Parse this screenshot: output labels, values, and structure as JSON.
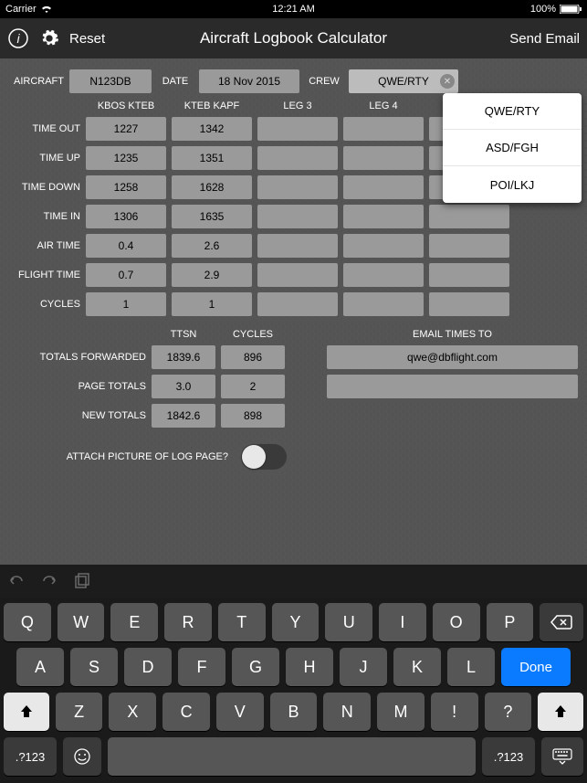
{
  "status": {
    "carrier": "Carrier",
    "time": "12:21 AM",
    "battery": "100%"
  },
  "nav": {
    "reset": "Reset",
    "title": "Aircraft Logbook Calculator",
    "sendEmail": "Send Email"
  },
  "header": {
    "aircraftLabel": "AIRCRAFT",
    "aircraft": "N123DB",
    "dateLabel": "DATE",
    "date": "18 Nov 2015",
    "crewLabel": "CREW",
    "crew": "QWE/RTY"
  },
  "crewOptions": [
    "QWE/RTY",
    "ASD/FGH",
    "POI/LKJ"
  ],
  "legHeaders": [
    "KBOS KTEB",
    "KTEB KAPF",
    "LEG 3",
    "LEG 4",
    ""
  ],
  "rowLabels": [
    "TIME OUT",
    "TIME UP",
    "TIME DOWN",
    "TIME IN",
    "AIR TIME",
    "FLIGHT TIME",
    "CYCLES"
  ],
  "grid": [
    [
      "1227",
      "1342",
      "",
      "",
      ""
    ],
    [
      "1235",
      "1351",
      "",
      "",
      ""
    ],
    [
      "1258",
      "1628",
      "",
      "",
      ""
    ],
    [
      "1306",
      "1635",
      "",
      "",
      ""
    ],
    [
      "0.4",
      "2.6",
      "",
      "",
      ""
    ],
    [
      "0.7",
      "2.9",
      "",
      "",
      ""
    ],
    [
      "1",
      "1",
      "",
      "",
      ""
    ]
  ],
  "totals": {
    "colHeaders": [
      "TTSN",
      "CYCLES"
    ],
    "emailHeader": "EMAIL TIMES TO",
    "rows": [
      {
        "label": "TOTALS FORWARDED",
        "ttsn": "1839.6",
        "cycles": "896"
      },
      {
        "label": "PAGE TOTALS",
        "ttsn": "3.0",
        "cycles": "2"
      },
      {
        "label": "NEW TOTALS",
        "ttsn": "1842.6",
        "cycles": "898"
      }
    ],
    "emails": [
      "qwe@dbflight.com",
      ""
    ]
  },
  "attachLabel": "ATTACH PICTURE OF LOG PAGE?",
  "keyboard": {
    "row1": [
      "Q",
      "W",
      "E",
      "R",
      "T",
      "Y",
      "U",
      "I",
      "O",
      "P"
    ],
    "row2": [
      "A",
      "S",
      "D",
      "F",
      "G",
      "H",
      "J",
      "K",
      "L"
    ],
    "row3": [
      "Z",
      "X",
      "C",
      "V",
      "B",
      "N",
      "M",
      "!",
      "?"
    ],
    "done": "Done",
    "numKey": ".?123"
  }
}
